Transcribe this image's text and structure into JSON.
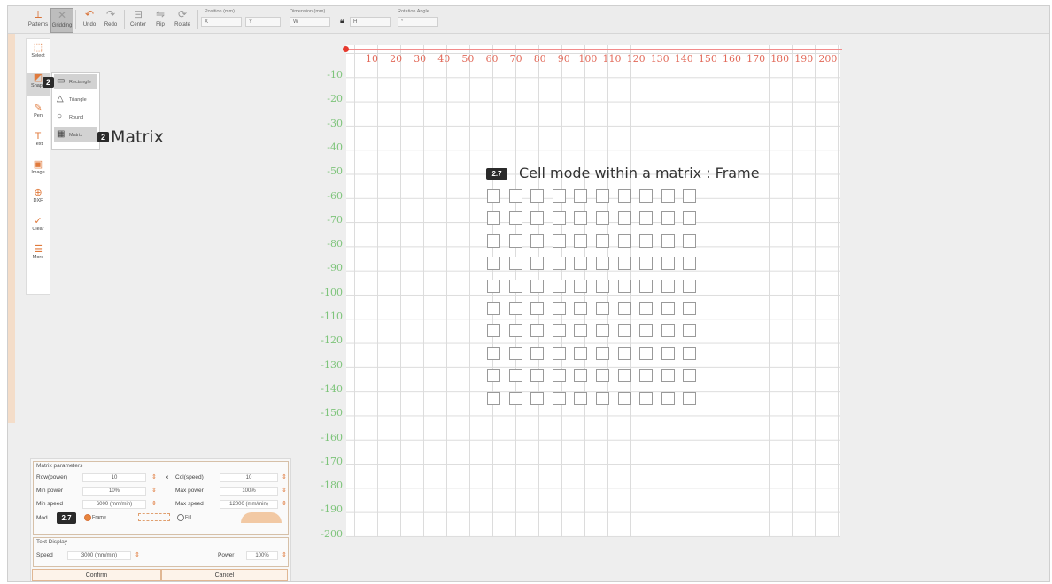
{
  "toolbar": {
    "buttons": [
      {
        "id": "pattern",
        "label": "Patterns",
        "icon": "laser-icon"
      },
      {
        "id": "grid",
        "label": "Gridding",
        "icon": "crosshatch-icon"
      },
      {
        "id": "undo",
        "label": "Undo",
        "icon": "undo-icon"
      },
      {
        "id": "redo",
        "label": "Redo",
        "icon": "redo-icon"
      },
      {
        "id": "center",
        "label": "Center",
        "icon": "center-icon"
      },
      {
        "id": "flip",
        "label": "Flip",
        "icon": "flip-icon"
      },
      {
        "id": "rotate",
        "label": "Rotate",
        "icon": "rotate-icon"
      }
    ],
    "position_label": "Position (mm)",
    "position_x": "X",
    "position_y": "Y",
    "dimension_label": "Dimension (mm)",
    "dimension_w": "W",
    "dimension_h": "H",
    "rotation_label": "Rotation Angle",
    "rotation_value": "°"
  },
  "sidebar": {
    "items": [
      {
        "label": "Select",
        "icon": "cursor-icon"
      },
      {
        "label": "Shape",
        "icon": "shape-icon"
      },
      {
        "label": "Pen",
        "icon": "pen-icon"
      },
      {
        "label": "Text",
        "icon": "text-icon"
      },
      {
        "label": "Image",
        "icon": "image-icon"
      },
      {
        "label": "DXF",
        "icon": "dxf-icon"
      },
      {
        "label": "Clear",
        "icon": "clear-icon"
      },
      {
        "label": "More",
        "icon": "more-icon"
      }
    ]
  },
  "flyout": {
    "items": [
      {
        "label": "Rectangle",
        "icon": "rectangle-icon"
      },
      {
        "label": "Triangle",
        "icon": "triangle-icon"
      },
      {
        "label": "Round",
        "icon": "circle-icon"
      },
      {
        "label": "Matrix",
        "icon": "grid-icon"
      }
    ]
  },
  "callouts": {
    "shape_badge": "2",
    "matrix_badge": "2",
    "matrix_text": "Matrix",
    "mode_badge": "2.7",
    "mode_text": "Cell mode within a matrix : Frame",
    "panel_badge": "2.7"
  },
  "ruler": {
    "x_ticks": [
      "10",
      "20",
      "30",
      "40",
      "50",
      "60",
      "70",
      "80",
      "90",
      "100",
      "110",
      "120",
      "130",
      "140",
      "150",
      "160",
      "170",
      "180",
      "190",
      "200"
    ],
    "y_ticks": [
      "-10",
      "-20",
      "-30",
      "-40",
      "-50",
      "-60",
      "-70",
      "-80",
      "-90",
      "-100",
      "-110",
      "-120",
      "-130",
      "-140",
      "-150",
      "-160",
      "-170",
      "-180",
      "-190",
      "-200"
    ]
  },
  "matrix_grid": {
    "rows": 10,
    "cols": 10
  },
  "matrix_panel": {
    "title": "Matrix parameters",
    "row_label": "Row(power)",
    "row_value": "10",
    "times": "x",
    "col_label": "Col(speed)",
    "col_value": "10",
    "min_power_label": "Min power",
    "min_power_value": "10%",
    "max_power_label": "Max power",
    "max_power_value": "100%",
    "min_speed_label": "Min speed",
    "min_speed_value": "6000 (mm/min)",
    "max_speed_label": "Max speed",
    "max_speed_value": "12000 (mm/min)",
    "mode_label": "Mod",
    "mode_frame": "Frame",
    "mode_fill": "Fill",
    "text_display_title": "Text Display",
    "speed_label": "Speed",
    "speed_value": "3000 (mm/min)",
    "power_label": "Power",
    "power_value": "100%",
    "confirm": "Confirm",
    "cancel": "Cancel"
  }
}
